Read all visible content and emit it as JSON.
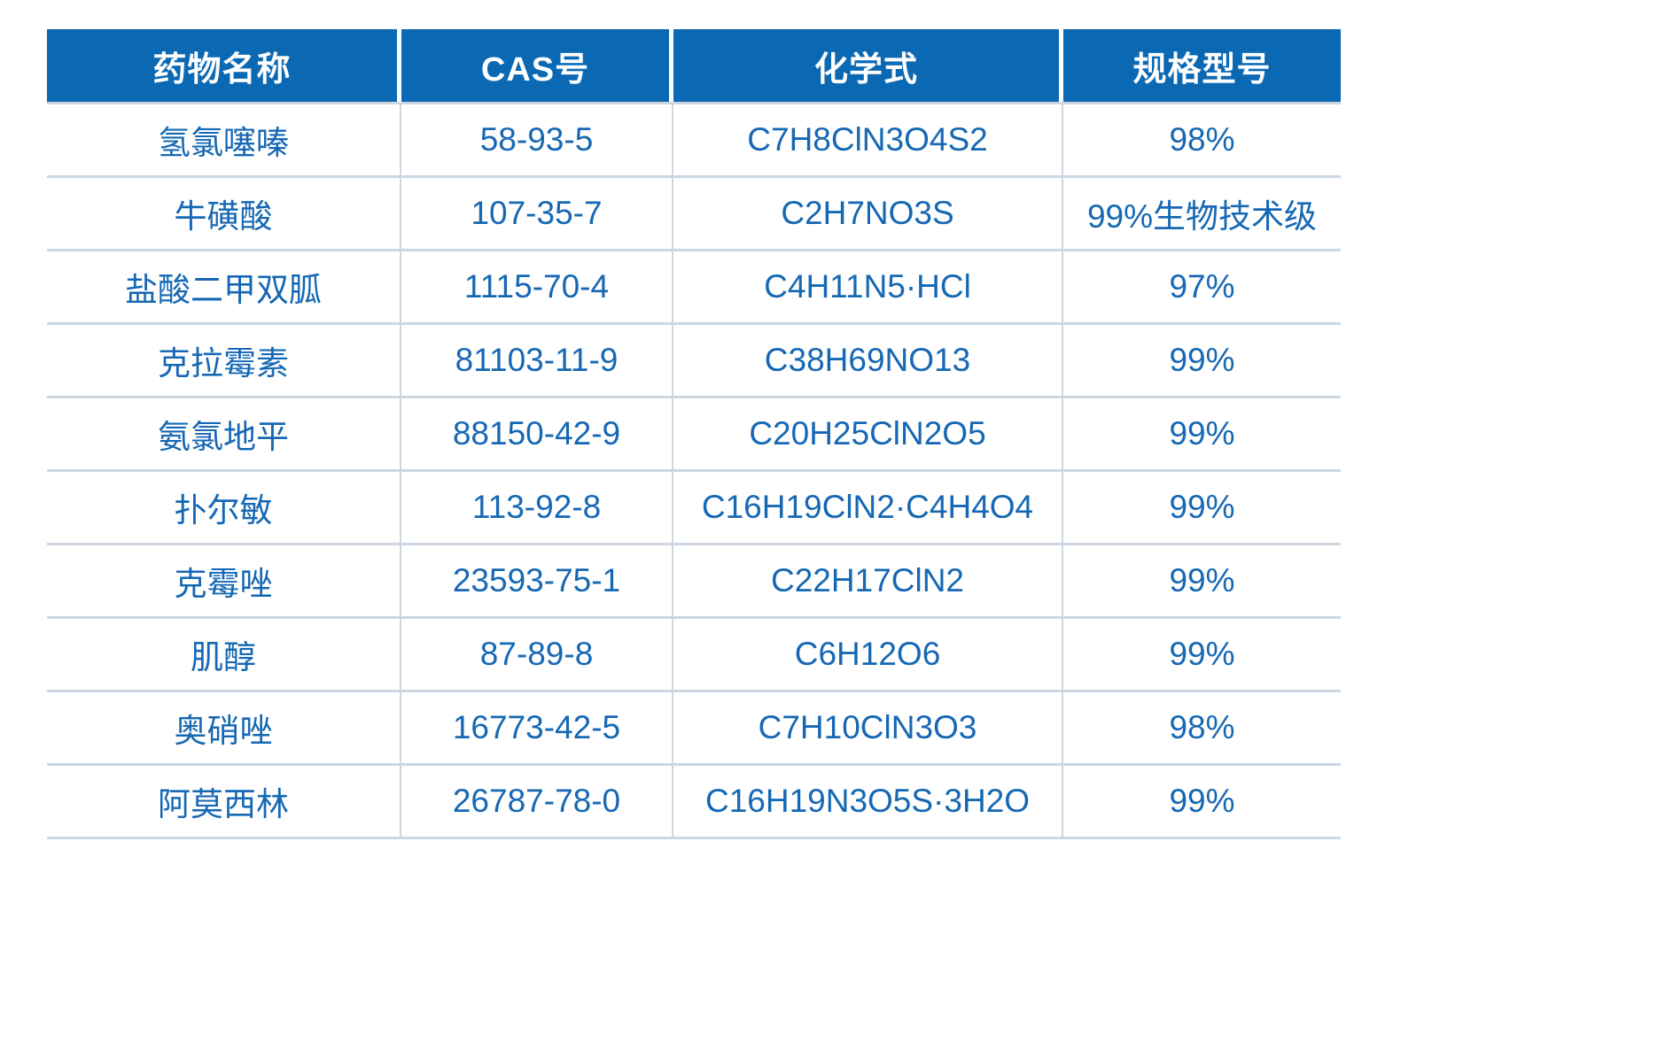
{
  "table": {
    "columns": [
      {
        "key": "name",
        "label": "药物名称"
      },
      {
        "key": "cas",
        "label": "CAS号"
      },
      {
        "key": "formula",
        "label": "化学式"
      },
      {
        "key": "spec",
        "label": "规格型号"
      }
    ],
    "rows": [
      {
        "name": "氢氯噻嗪",
        "cas": "58-93-5",
        "formula": "C7H8ClN3O4S2",
        "spec": "98%"
      },
      {
        "name": "牛磺酸",
        "cas": "107-35-7",
        "formula": "C2H7NO3S",
        "spec": "99%生物技术级"
      },
      {
        "name": "盐酸二甲双胍",
        "cas": "1115-70-4",
        "formula": "C4H11N5·HCl",
        "spec": "97%"
      },
      {
        "name": "克拉霉素",
        "cas": "81103-11-9",
        "formula": "C38H69NO13",
        "spec": "99%"
      },
      {
        "name": "氨氯地平",
        "cas": "88150-42-9",
        "formula": "C20H25ClN2O5",
        "spec": "99%"
      },
      {
        "name": "扑尔敏",
        "cas": "113-92-8",
        "formula": "C16H19ClN2·C4H4O4",
        "spec": "99%"
      },
      {
        "name": "克霉唑",
        "cas": "23593-75-1",
        "formula": "C22H17ClN2",
        "spec": "99%"
      },
      {
        "name": "肌醇",
        "cas": "87-89-8",
        "formula": "C6H12O6",
        "spec": "99%"
      },
      {
        "name": "奥硝唑",
        "cas": "16773-42-5",
        "formula": "C7H10ClN3O3",
        "spec": "98%"
      },
      {
        "name": "阿莫西林",
        "cas": "26787-78-0",
        "formula": "C16H19N3O5S·3H2O",
        "spec": "99%"
      }
    ]
  },
  "colors": {
    "header_background": "#0b69b4",
    "header_text": "#ffffff",
    "cell_text": "#1668b4",
    "grid_line": "#ccd7e1",
    "page_background": "#ffffff"
  }
}
